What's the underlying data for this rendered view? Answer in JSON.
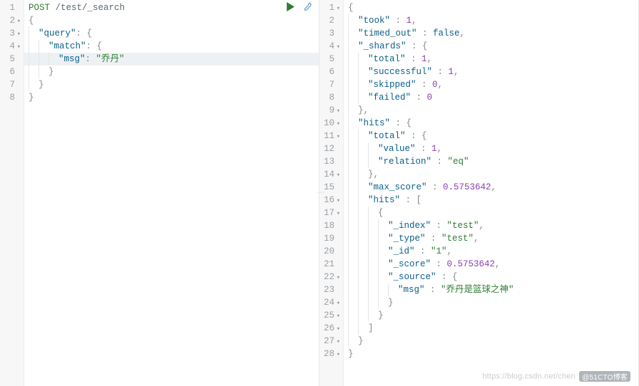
{
  "left": {
    "toolbar": {
      "run_color": "#2e7d32",
      "wrench_color": "#6aa6c9"
    },
    "lines": [
      {
        "n": "1",
        "fold": false,
        "hl": false,
        "tokens": [
          {
            "cls": "t-post",
            "txt": "POST"
          },
          {
            "txt": " "
          },
          {
            "cls": "t-path",
            "txt": "/test/_search"
          }
        ]
      },
      {
        "n": "2",
        "fold": true,
        "hl": false,
        "tokens": [
          {
            "cls": "t-punc",
            "txt": "{"
          }
        ]
      },
      {
        "n": "3",
        "fold": true,
        "hl": false,
        "tokens": [
          {
            "ind": 1
          },
          {
            "cls": "t-key",
            "txt": "\"query\""
          },
          {
            "cls": "t-punc",
            "txt": ": {"
          }
        ]
      },
      {
        "n": "4",
        "fold": true,
        "hl": false,
        "tokens": [
          {
            "ind": 2
          },
          {
            "cls": "t-key",
            "txt": "\"match\""
          },
          {
            "cls": "t-punc",
            "txt": ": {"
          }
        ]
      },
      {
        "n": "5",
        "fold": false,
        "hl": true,
        "tokens": [
          {
            "ind": 3
          },
          {
            "cls": "t-key",
            "txt": "\"msg\""
          },
          {
            "cls": "t-punc",
            "txt": ": "
          },
          {
            "cls": "t-str",
            "txt": "\"乔丹\""
          }
        ]
      },
      {
        "n": "6",
        "fold": false,
        "hl": false,
        "tokens": [
          {
            "ind": 2
          },
          {
            "cls": "t-punc",
            "txt": "}"
          }
        ]
      },
      {
        "n": "7",
        "fold": false,
        "hl": false,
        "tokens": [
          {
            "ind": 1
          },
          {
            "cls": "t-punc",
            "txt": "}"
          }
        ]
      },
      {
        "n": "8",
        "fold": false,
        "hl": false,
        "tokens": [
          {
            "cls": "t-punc",
            "txt": "}"
          }
        ]
      }
    ]
  },
  "right": {
    "lines": [
      {
        "n": "1",
        "fold": true,
        "tokens": [
          {
            "cls": "t-punc",
            "txt": "{"
          }
        ]
      },
      {
        "n": "2",
        "fold": false,
        "tokens": [
          {
            "ind": 1
          },
          {
            "cls": "t-key",
            "txt": "\"took\""
          },
          {
            "cls": "t-punc",
            "txt": " : "
          },
          {
            "cls": "t-num",
            "txt": "1"
          },
          {
            "cls": "t-punc",
            "txt": ","
          }
        ]
      },
      {
        "n": "3",
        "fold": false,
        "tokens": [
          {
            "ind": 1
          },
          {
            "cls": "t-key",
            "txt": "\"timed_out\""
          },
          {
            "cls": "t-punc",
            "txt": " : "
          },
          {
            "cls": "t-bool",
            "txt": "false"
          },
          {
            "cls": "t-punc",
            "txt": ","
          }
        ]
      },
      {
        "n": "4",
        "fold": true,
        "tokens": [
          {
            "ind": 1
          },
          {
            "cls": "t-key",
            "txt": "\"_shards\""
          },
          {
            "cls": "t-punc",
            "txt": " : {"
          }
        ]
      },
      {
        "n": "5",
        "fold": false,
        "tokens": [
          {
            "ind": 2
          },
          {
            "cls": "t-key",
            "txt": "\"total\""
          },
          {
            "cls": "t-punc",
            "txt": " : "
          },
          {
            "cls": "t-num",
            "txt": "1"
          },
          {
            "cls": "t-punc",
            "txt": ","
          }
        ]
      },
      {
        "n": "6",
        "fold": false,
        "tokens": [
          {
            "ind": 2
          },
          {
            "cls": "t-key",
            "txt": "\"successful\""
          },
          {
            "cls": "t-punc",
            "txt": " : "
          },
          {
            "cls": "t-num",
            "txt": "1"
          },
          {
            "cls": "t-punc",
            "txt": ","
          }
        ]
      },
      {
        "n": "7",
        "fold": false,
        "tokens": [
          {
            "ind": 2
          },
          {
            "cls": "t-key",
            "txt": "\"skipped\""
          },
          {
            "cls": "t-punc",
            "txt": " : "
          },
          {
            "cls": "t-num",
            "txt": "0"
          },
          {
            "cls": "t-punc",
            "txt": ","
          }
        ]
      },
      {
        "n": "8",
        "fold": false,
        "tokens": [
          {
            "ind": 2
          },
          {
            "cls": "t-key",
            "txt": "\"failed\""
          },
          {
            "cls": "t-punc",
            "txt": " : "
          },
          {
            "cls": "t-num",
            "txt": "0"
          }
        ]
      },
      {
        "n": "9",
        "fold": true,
        "tokens": [
          {
            "ind": 1
          },
          {
            "cls": "t-punc",
            "txt": "},"
          }
        ]
      },
      {
        "n": "10",
        "fold": true,
        "tokens": [
          {
            "ind": 1
          },
          {
            "cls": "t-key",
            "txt": "\"hits\""
          },
          {
            "cls": "t-punc",
            "txt": " : {"
          }
        ]
      },
      {
        "n": "11",
        "fold": true,
        "tokens": [
          {
            "ind": 2
          },
          {
            "cls": "t-key",
            "txt": "\"total\""
          },
          {
            "cls": "t-punc",
            "txt": " : {"
          }
        ]
      },
      {
        "n": "12",
        "fold": false,
        "tokens": [
          {
            "ind": 3
          },
          {
            "cls": "t-key",
            "txt": "\"value\""
          },
          {
            "cls": "t-punc",
            "txt": " : "
          },
          {
            "cls": "t-num",
            "txt": "1"
          },
          {
            "cls": "t-punc",
            "txt": ","
          }
        ]
      },
      {
        "n": "13",
        "fold": false,
        "tokens": [
          {
            "ind": 3
          },
          {
            "cls": "t-key",
            "txt": "\"relation\""
          },
          {
            "cls": "t-punc",
            "txt": " : "
          },
          {
            "cls": "t-str",
            "txt": "\"eq\""
          }
        ]
      },
      {
        "n": "14",
        "fold": true,
        "tokens": [
          {
            "ind": 2
          },
          {
            "cls": "t-punc",
            "txt": "},"
          }
        ]
      },
      {
        "n": "15",
        "fold": false,
        "tokens": [
          {
            "ind": 2
          },
          {
            "cls": "t-key",
            "txt": "\"max_score\""
          },
          {
            "cls": "t-punc",
            "txt": " : "
          },
          {
            "cls": "t-num",
            "txt": "0.5753642"
          },
          {
            "cls": "t-punc",
            "txt": ","
          }
        ]
      },
      {
        "n": "16",
        "fold": true,
        "tokens": [
          {
            "ind": 2
          },
          {
            "cls": "t-key",
            "txt": "\"hits\""
          },
          {
            "cls": "t-punc",
            "txt": " : ["
          }
        ]
      },
      {
        "n": "17",
        "fold": true,
        "tokens": [
          {
            "ind": 3
          },
          {
            "cls": "t-punc",
            "txt": "{"
          }
        ]
      },
      {
        "n": "18",
        "fold": false,
        "tokens": [
          {
            "ind": 4
          },
          {
            "cls": "t-key",
            "txt": "\"_index\""
          },
          {
            "cls": "t-punc",
            "txt": " : "
          },
          {
            "cls": "t-str",
            "txt": "\"test\""
          },
          {
            "cls": "t-punc",
            "txt": ","
          }
        ]
      },
      {
        "n": "19",
        "fold": false,
        "tokens": [
          {
            "ind": 4
          },
          {
            "cls": "t-key",
            "txt": "\"_type\""
          },
          {
            "cls": "t-punc",
            "txt": " : "
          },
          {
            "cls": "t-str",
            "txt": "\"test\""
          },
          {
            "cls": "t-punc",
            "txt": ","
          }
        ]
      },
      {
        "n": "20",
        "fold": false,
        "tokens": [
          {
            "ind": 4
          },
          {
            "cls": "t-key",
            "txt": "\"_id\""
          },
          {
            "cls": "t-punc",
            "txt": " : "
          },
          {
            "cls": "t-str",
            "txt": "\"1\""
          },
          {
            "cls": "t-punc",
            "txt": ","
          }
        ]
      },
      {
        "n": "21",
        "fold": false,
        "tokens": [
          {
            "ind": 4
          },
          {
            "cls": "t-key",
            "txt": "\"_score\""
          },
          {
            "cls": "t-punc",
            "txt": " : "
          },
          {
            "cls": "t-num",
            "txt": "0.5753642"
          },
          {
            "cls": "t-punc",
            "txt": ","
          }
        ]
      },
      {
        "n": "22",
        "fold": true,
        "tokens": [
          {
            "ind": 4
          },
          {
            "cls": "t-key",
            "txt": "\"_source\""
          },
          {
            "cls": "t-punc",
            "txt": " : {"
          }
        ]
      },
      {
        "n": "23",
        "fold": false,
        "tokens": [
          {
            "ind": 5
          },
          {
            "cls": "t-key",
            "txt": "\"msg\""
          },
          {
            "cls": "t-punc",
            "txt": " : "
          },
          {
            "cls": "t-str",
            "txt": "\"乔丹是篮球之神\""
          }
        ]
      },
      {
        "n": "24",
        "fold": true,
        "tokens": [
          {
            "ind": 4
          },
          {
            "cls": "t-punc",
            "txt": "}"
          }
        ]
      },
      {
        "n": "25",
        "fold": true,
        "tokens": [
          {
            "ind": 3
          },
          {
            "cls": "t-punc",
            "txt": "}"
          }
        ]
      },
      {
        "n": "26",
        "fold": true,
        "tokens": [
          {
            "ind": 2
          },
          {
            "cls": "t-punc",
            "txt": "]"
          }
        ]
      },
      {
        "n": "27",
        "fold": true,
        "tokens": [
          {
            "ind": 1
          },
          {
            "cls": "t-punc",
            "txt": "}"
          }
        ]
      },
      {
        "n": "28",
        "fold": true,
        "tokens": [
          {
            "cls": "t-punc",
            "txt": "}"
          }
        ]
      }
    ]
  },
  "watermark": {
    "url": "https://blog.csdn.net/chen",
    "badge": "@51CTO博客"
  },
  "divider_glyph": "⋮"
}
